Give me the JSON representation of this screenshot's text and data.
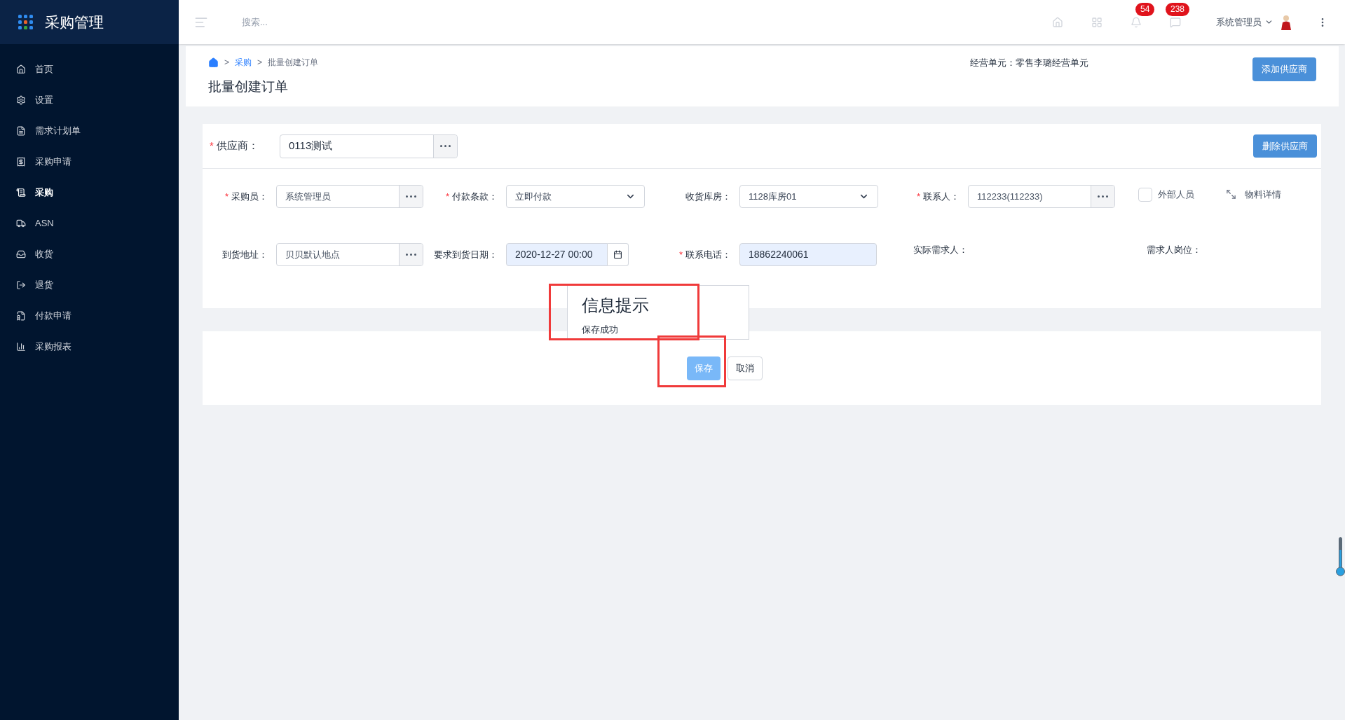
{
  "app": {
    "title": "采购管理"
  },
  "sidebar": {
    "items": [
      {
        "label": "首页",
        "selected": false
      },
      {
        "label": "设置",
        "selected": false
      },
      {
        "label": "需求计划单",
        "selected": false
      },
      {
        "label": "采购申请",
        "selected": false
      },
      {
        "label": "采购",
        "selected": true
      },
      {
        "label": "ASN",
        "selected": false
      },
      {
        "label": "收货",
        "selected": false
      },
      {
        "label": "退货",
        "selected": false
      },
      {
        "label": "付款申请",
        "selected": false
      },
      {
        "label": "采购报表",
        "selected": false
      }
    ]
  },
  "topbar": {
    "search_placeholder": "搜索...",
    "notifications": "54",
    "messages": "238",
    "user": "系统管理员"
  },
  "breadcrumb": [
    {
      "separator": ">",
      "label": "采购",
      "link": true
    },
    {
      "separator": ">",
      "label": "批量创建订单",
      "link": false
    }
  ],
  "page_title": "批量创建订单",
  "business_unit": {
    "label": "经营单元：",
    "value": "零售李璐经营单元"
  },
  "add_supplier_button": "添加供应商",
  "supplier": {
    "required_mark": "*",
    "label": "供应商：",
    "value": "0113测试"
  },
  "delete_supplier_button": "删除供应商",
  "rows": [
    [
      {
        "kind": "lookup",
        "required_mark": "*",
        "label": "采购员：",
        "value": "系统管理员"
      },
      {
        "kind": "select",
        "required_mark": "*",
        "label": "付款条款：",
        "value": "立即付款"
      },
      {
        "kind": "select",
        "label": "收货库房：",
        "value": "1128库房01"
      },
      {
        "kind": "lookup",
        "required_mark": "*",
        "label": "联系人：",
        "value": "112233(112233)"
      },
      {
        "kind": "checkbox",
        "label": "外部人员",
        "checked": false
      },
      {
        "kind": "link",
        "label": "物料详情"
      }
    ],
    [
      {
        "kind": "lookup",
        "label": "到货地址：",
        "value": "贝贝默认地点"
      },
      {
        "kind": "date",
        "label": "要求到货日期：",
        "value": "2020-12-27 00:00"
      },
      {
        "kind": "text",
        "required_mark": "*",
        "label": "联系电话：",
        "value": "18862240061"
      },
      {
        "kind": "static",
        "label": "实际需求人："
      },
      {
        "kind": "static",
        "label": "需求人岗位："
      }
    ]
  ],
  "actions": {
    "save": "保存",
    "cancel": "取消"
  },
  "toast": {
    "title": "信息提示",
    "message": "保存成功"
  }
}
